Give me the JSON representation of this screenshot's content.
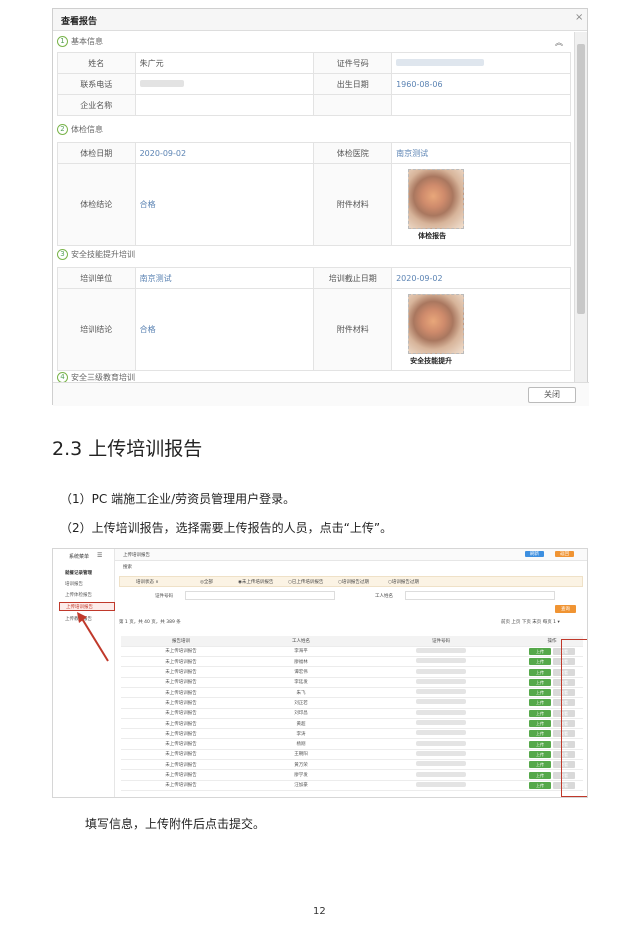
{
  "dialog": {
    "title": "查看报告",
    "close_icon": "×",
    "collapse_icon": "︽",
    "sections": [
      {
        "num": "1",
        "title": "基本信息"
      },
      {
        "num": "2",
        "title": "体检信息"
      },
      {
        "num": "3",
        "title": "安全技能提升培训"
      },
      {
        "num": "4",
        "title": "安全三级教育培训"
      }
    ],
    "basic": {
      "name_label": "姓名",
      "name_value": "朱广元",
      "id_label": "证件号码",
      "id_value": "",
      "phone_label": "联系电话",
      "phone_value": "",
      "birth_label": "出生日期",
      "birth_value": "1960-08-06",
      "company_label": "企业名称",
      "company_value": ""
    },
    "exam": {
      "date_label": "体检日期",
      "date_value": "2020-09-02",
      "hospital_label": "体检医院",
      "hospital_value": "南京测试",
      "result_label": "体检结论",
      "result_value": "合格",
      "attach_label": "附件材料",
      "attach_caption": "体检报告"
    },
    "training": {
      "unit_label": "培训单位",
      "unit_value": "南京测试",
      "end_label": "培训截止日期",
      "end_value": "2020-09-02",
      "result_label": "培训结论",
      "result_value": "合格",
      "attach_label": "附件材料",
      "attach_caption": "安全技能提升"
    },
    "close_button": "关闭"
  },
  "heading": "2.3 上传培训报告",
  "steps": [
    "（1）PC 端施工企业/劳资员管理用户登录。",
    "（2）上传培训报告，选择需要上传报告的人员，点击“上传”。"
  ],
  "screenshot2": {
    "sidebar_title": "系统菜单",
    "sidebar_items": [
      "就餐记录管理",
      "培训报告",
      "上传体检报告",
      "上传培训报告",
      "上传教育报告"
    ],
    "page_title": "上传培训报告",
    "refresh_label": "刷新",
    "back_label": "返回",
    "search_label": "搜索",
    "filter_tabs": [
      "培训状态 ∨",
      "◎全部",
      "◉未上传培训报告",
      "○已上传培训报告",
      "○培训报告过期",
      "○培训报告过期"
    ],
    "id_field_label": "证件号码",
    "worker_field_label": "工人姓名",
    "query_button": "查询",
    "pagination_left": "第 1 页，共 40 页，共 389 条",
    "pagination_right": "前页 上页 下页 末页 每页 1 ▾",
    "columns": [
      "报告培训",
      "工人姓名",
      "证件号码",
      "操作"
    ],
    "rows": [
      {
        "status": "未上传培训报告",
        "name": "李海平"
      },
      {
        "status": "未上传培训报告",
        "name": "廖福林"
      },
      {
        "status": "未上传培训报告",
        "name": "谭宏伟"
      },
      {
        "status": "未上传培训报告",
        "name": "李廷发"
      },
      {
        "status": "未上传培训报告",
        "name": "朱飞"
      },
      {
        "status": "未上传培训报告",
        "name": "刘正若"
      },
      {
        "status": "未上传培训报告",
        "name": "刘印昌"
      },
      {
        "status": "未上传培训报告",
        "name": "黄超"
      },
      {
        "status": "未上传培训报告",
        "name": "李涛"
      },
      {
        "status": "未上传培训报告",
        "name": "杨刚"
      },
      {
        "status": "未上传培训报告",
        "name": "王朝阳"
      },
      {
        "status": "未上传培训报告",
        "name": "黄万荣"
      },
      {
        "status": "未上传培训报告",
        "name": "廖学发"
      },
      {
        "status": "未上传培训报告",
        "name": "汪加豪"
      }
    ],
    "upload_label": "上传",
    "view_label": "查看",
    "highlight_color": "#c0392b",
    "action_color": "#55a84a"
  },
  "note": "填写信息，上传附件后点击提交。",
  "page_number": "12"
}
